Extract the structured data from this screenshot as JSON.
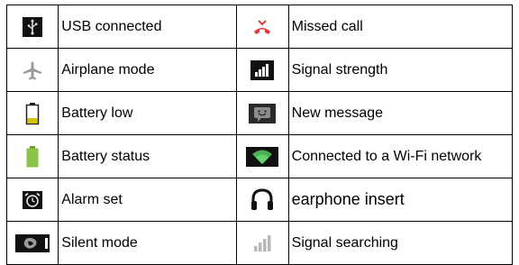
{
  "rows": [
    {
      "left": {
        "icon": "usb-icon",
        "label": "USB connected"
      },
      "right": {
        "icon": "missed-call-icon",
        "label": "Missed call"
      }
    },
    {
      "left": {
        "icon": "airplane-icon",
        "label": "Airplane mode"
      },
      "right": {
        "icon": "signal-strength-icon",
        "label": "Signal strength"
      }
    },
    {
      "left": {
        "icon": "battery-low-icon",
        "label": "Battery low"
      },
      "right": {
        "icon": "new-message-icon",
        "label": "New message"
      }
    },
    {
      "left": {
        "icon": "battery-status-icon",
        "label": "Battery status"
      },
      "right": {
        "icon": "wifi-icon",
        "label": "Connected to a Wi-Fi network"
      }
    },
    {
      "left": {
        "icon": "alarm-icon",
        "label": "Alarm set"
      },
      "right": {
        "icon": "earphone-icon",
        "label": "earphone insert"
      }
    },
    {
      "left": {
        "icon": "silent-mode-icon",
        "label": "Silent mode"
      },
      "right": {
        "icon": "signal-searching-icon",
        "label": "Signal searching"
      }
    }
  ],
  "colors": {
    "missed_call": "#e53935",
    "battery_low": "#d4c400",
    "battery_green": "#8bc34a",
    "wifi_green": "#4caf50",
    "icon_dark": "#111111",
    "signal_gray": "#b8b8b8"
  }
}
